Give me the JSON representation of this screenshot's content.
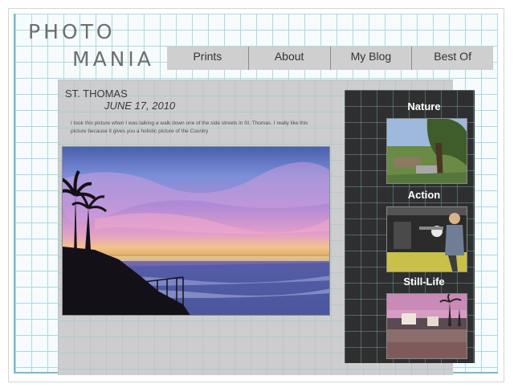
{
  "logo": {
    "line1": "PHOTO",
    "line2": "MANIA"
  },
  "nav": {
    "items": [
      {
        "label": "Prints"
      },
      {
        "label": "About"
      },
      {
        "label": "My Blog"
      },
      {
        "label": "Best Of"
      }
    ]
  },
  "post": {
    "title": "ST. THOMAS",
    "date": "JUNE 17, 2010",
    "body": "I took this picture when I was talking a walk down one of the side streets in St. Thomas. I really like this picture because it gives you a holistic picture of the Country"
  },
  "sidebar": {
    "categories": [
      {
        "label": "Nature"
      },
      {
        "label": "Action"
      },
      {
        "label": "Still-Life"
      }
    ]
  },
  "colors": {
    "sidebar_bg": "#2f2f2f",
    "nav_bg": "#cfcfcf",
    "grid_line": "#aed8e2"
  }
}
